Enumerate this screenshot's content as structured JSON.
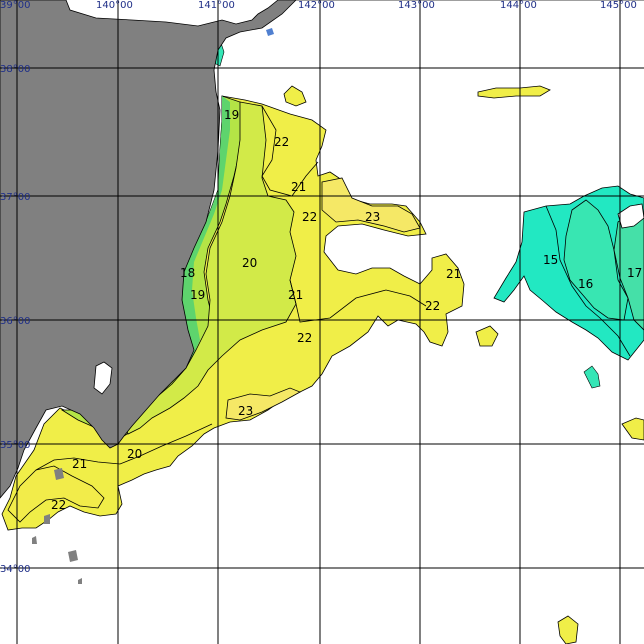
{
  "colors": {
    "land": "#808080",
    "grid": "#000000",
    "coord_text": "#1f2f88",
    "sst_16": "#35e6b6",
    "sst_18": "#5ed46d",
    "sst_19": "#9ee046",
    "sst_20": "#cfe84a",
    "sst_21": "#e8ec44",
    "sst_22": "#f0ee48",
    "sst_23": "#f5ea6a",
    "sst_15": "#1ee8c0"
  },
  "longitude_labels": [
    "39°00",
    "140°00",
    "141°00",
    "142°00",
    "143°00",
    "144°00",
    "145°00"
  ],
  "latitude_labels": [
    "38°00",
    "37°00",
    "36°00",
    "35°00",
    "34°00"
  ],
  "isotherm_labels": [
    {
      "text": "19",
      "value": 19
    },
    {
      "text": "22",
      "value": 22
    },
    {
      "text": "21",
      "value": 21
    },
    {
      "text": "22",
      "value": 22
    },
    {
      "text": "23",
      "value": 23
    },
    {
      "text": "20",
      "value": 20
    },
    {
      "text": "18",
      "value": 18
    },
    {
      "text": "19",
      "value": 19
    },
    {
      "text": "21",
      "value": 21
    },
    {
      "text": "21",
      "value": 21
    },
    {
      "text": "22",
      "value": 22
    },
    {
      "text": "22",
      "value": 22
    },
    {
      "text": "23",
      "value": 23
    },
    {
      "text": "21",
      "value": 21
    },
    {
      "text": "20",
      "value": 20
    },
    {
      "text": "22",
      "value": 22
    },
    {
      "text": "15",
      "value": 15
    },
    {
      "text": "16",
      "value": 16
    },
    {
      "text": "17",
      "value": 17
    }
  ]
}
